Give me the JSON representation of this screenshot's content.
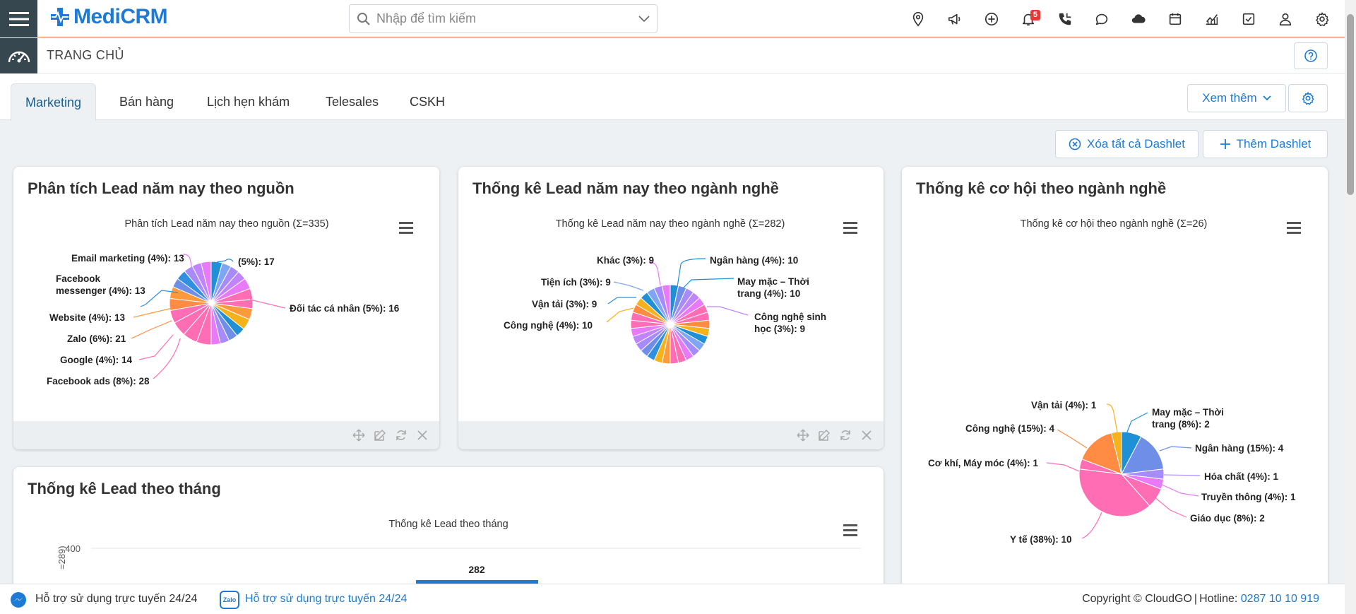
{
  "app": {
    "logo_text": "MediCRM",
    "page_title": "TRANG CHỦ"
  },
  "search": {
    "placeholder": "Nhập để tìm kiếm"
  },
  "topbar": {
    "icons": [
      "location-icon",
      "megaphone-icon",
      "plus-circle-icon",
      "bell-icon",
      "phone-icon",
      "chat-icon",
      "cloud-icon",
      "calendar-icon",
      "chart-icon",
      "checkbox-icon",
      "user-icon",
      "gear-icon"
    ],
    "notification_count": "5"
  },
  "tabs": [
    {
      "label": "Marketing",
      "active": true
    },
    {
      "label": "Bán hàng"
    },
    {
      "label": "Lịch hẹn khám"
    },
    {
      "label": "Telesales"
    },
    {
      "label": "CSKH"
    }
  ],
  "actions": {
    "more_label": "Xem thêm",
    "delete_all_label": "Xóa tất cả Dashlet",
    "add_label": "Thêm Dashlet"
  },
  "dashlets": {
    "source": {
      "title": "Phân tích Lead năm nay theo nguồn",
      "chart_title": "Phân tích Lead năm nay theo nguồn (Σ=335)"
    },
    "industry": {
      "title": "Thống kê Lead năm nay theo ngành nghề",
      "chart_title": "Thống kê Lead năm nay theo ngành nghề (Σ=282)"
    },
    "opportunity": {
      "title": "Thống kê cơ hội theo ngành nghề",
      "chart_title": "Thống kê cơ hội theo ngành nghề (Σ=26)"
    },
    "monthly": {
      "title": "Thống kê Lead theo tháng",
      "chart_title": "Thống kê Lead theo tháng",
      "y_axis_partial": "=289)",
      "tick_400": "400",
      "bar_label": "282"
    }
  },
  "chart_data": [
    {
      "type": "pie",
      "title": "Phân tích Lead năm nay theo nguồn (Σ=335)",
      "labels": [
        "(5%): 17",
        "Đối tác cá nhân (5%): 16",
        "Facebook ads (8%): 28",
        "Google (4%): 14",
        "Zalo (6%): 21",
        "Website (4%): 13",
        "Facebook messenger (4%): 13",
        "Email marketing (4%): 13"
      ],
      "values": [
        17,
        16,
        28,
        14,
        21,
        13,
        13,
        13
      ]
    },
    {
      "type": "pie",
      "title": "Thống kê Lead năm nay theo ngành nghề (Σ=282)",
      "labels": [
        "Ngân hàng (4%): 10",
        "May mặc - Thời trang (4%): 10",
        "Công nghệ sinh học (3%): 9",
        "Công nghệ (4%): 10",
        "Vận tải (3%): 9",
        "Tiện ích (3%): 9",
        "Khác (3%): 9"
      ],
      "values": [
        10,
        10,
        9,
        10,
        9,
        9,
        9
      ]
    },
    {
      "type": "pie",
      "title": "Thống kê cơ hội theo ngành nghề (Σ=26)",
      "labels": [
        "May mặc - Thời trang (8%): 2",
        "Ngân hàng (15%): 4",
        "Hóa chất (4%): 1",
        "Truyền thông (4%): 1",
        "Giáo dục (8%): 2",
        "Y tế (38%): 10",
        "Cơ khí, Máy móc (4%): 1",
        "Công nghệ (15%): 4",
        "Vận tải (4%): 1"
      ],
      "values": [
        2,
        4,
        1,
        1,
        2,
        10,
        1,
        4,
        1
      ]
    },
    {
      "type": "bar",
      "title": "Thống kê Lead theo tháng",
      "values": [
        282
      ],
      "ylim": [
        0,
        400
      ]
    }
  ],
  "footer": {
    "support_text": "Hỗ trợ sử dụng trực tuyến 24/24",
    "zalo_support_text": "Hỗ trợ sử dụng trực tuyến 24/24",
    "copyright": "Copyright © CloudGO",
    "hotline_label": "Hotline:",
    "hotline_number": "0287 10 10 919"
  },
  "colors": {
    "accent": "#1d7bd3",
    "dark": "#37474f",
    "pink": "#ff6eb4",
    "orange": "#ff9a3c",
    "purple": "#a78bfa",
    "blue": "#2f8fe0"
  }
}
